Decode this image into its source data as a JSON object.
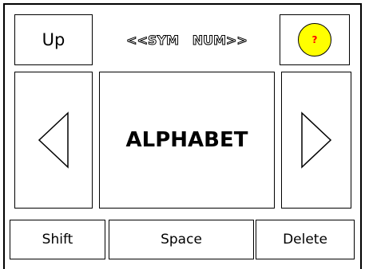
{
  "keyboard": {
    "up_label": "Up",
    "mode_switch_label": "<<SYM   NUM>>",
    "help_label": "?",
    "center_label": "ALPHABET",
    "left_arrow_icon": "left-triangle-arrow",
    "right_arrow_icon": "right-triangle-arrow",
    "shift_label": "Shift",
    "space_label": "Space",
    "delete_label": "Delete"
  },
  "colors": {
    "help_background": "#ffff00",
    "help_text": "#ff0000",
    "border": "#000000"
  }
}
